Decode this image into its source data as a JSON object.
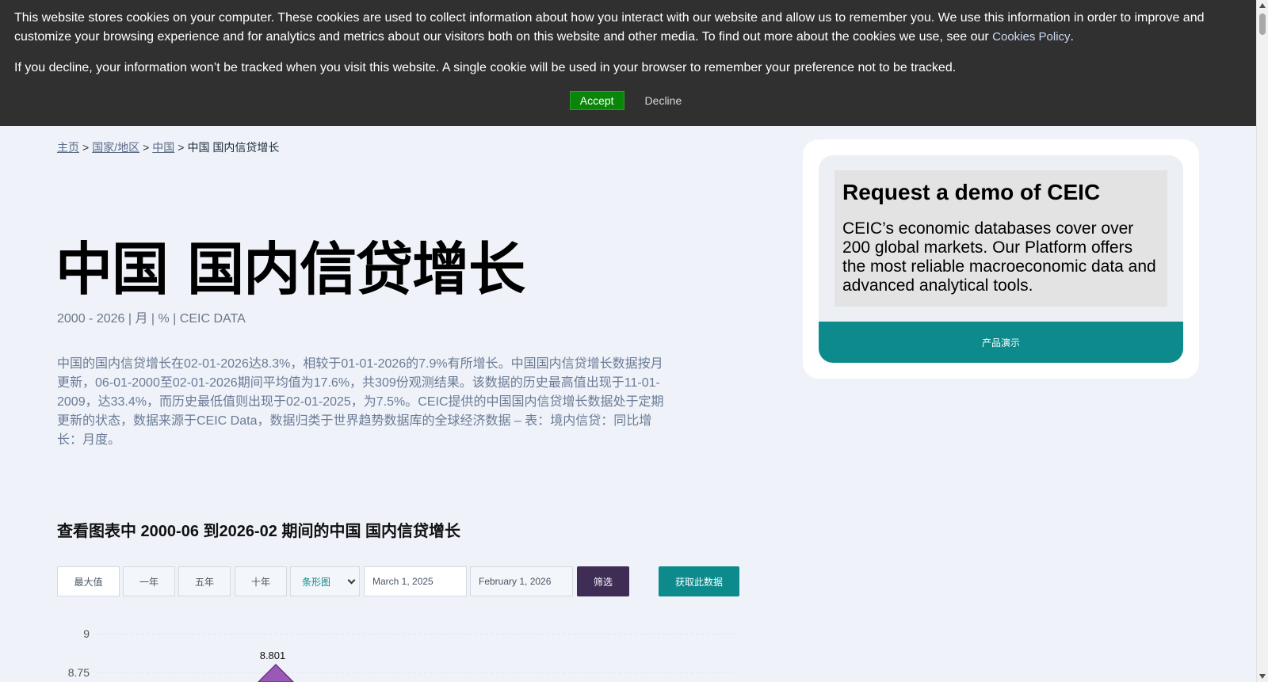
{
  "cookie_banner": {
    "text1": "This website stores cookies on your computer. These cookies are used to collect information about how you interact with our website and allow us to remember you. We use this information in order to improve and customize your browsing experience and for analytics and metrics about our visitors both on this website and other media. To find out more about the cookies we use, see our",
    "policy_link": "Cookies Policy",
    "text2": "If you decline, your information won’t be tracked when you visit this website. A single cookie will be used in your browser to remember your preference not to be tracked.",
    "accept_label": "Accept",
    "decline_label": "Decline"
  },
  "breadcrumb": {
    "home": "主页",
    "countries": "国家/地区",
    "china": "中国",
    "current": "中国 国内信贷增长",
    "separator": ">"
  },
  "page": {
    "title": "中国 国内信贷增长",
    "subtitle": "2000 - 2026 | 月 | % | CEIC DATA",
    "description": "中国的国内信贷增长在02-01-2026达8.3%，相较于01-01-2026的7.9%有所增长。中国国内信贷增长数据按月更新，06-01-2000至02-01-2026期间平均值为17.6%，共309份观测结果。该数据的历史最高值出现于11-01-2009，达33.4%，而历史最低值则出现于02-01-2025，为7.5%。CEIC提供的中国国内信贷增长数据处于定期更新的状态，数据来源于CEIC Data，数据归类于世界趋势数据库的全球经济数据 – 表：境内信贷：同比增长：月度。",
    "section_title": "查看图表中 2000-06 到2026-02 期间的中国 国内信贷增长"
  },
  "controls": {
    "max": "最大值",
    "one_year": "一年",
    "five_year": "五年",
    "ten_year": "十年",
    "chart_type": "条形图",
    "start_date": "March 1, 2025",
    "end_date": "February 1, 2026",
    "filter": "筛选",
    "get_data": "获取此数据"
  },
  "chart_data": {
    "type": "line",
    "y_ticks": [
      "9",
      "8.75"
    ],
    "peak_label": "8.801",
    "visible_points": [
      {
        "label": "8.801",
        "y": 8.801
      }
    ],
    "ylim_visible": [
      8.75,
      9
    ],
    "color": "#7d3c98"
  },
  "demo_card": {
    "heading": "Request a demo of CEIC",
    "body": "CEIC’s economic databases cover over 200 global markets. Our Platform offers the most reliable macroeconomic data and advanced analytical tools.",
    "button": "产品演示"
  },
  "colors": {
    "teal": "#0c8a8c",
    "purple": "#3f2d56",
    "accept_green": "#098609",
    "banner_bg": "#303030"
  }
}
